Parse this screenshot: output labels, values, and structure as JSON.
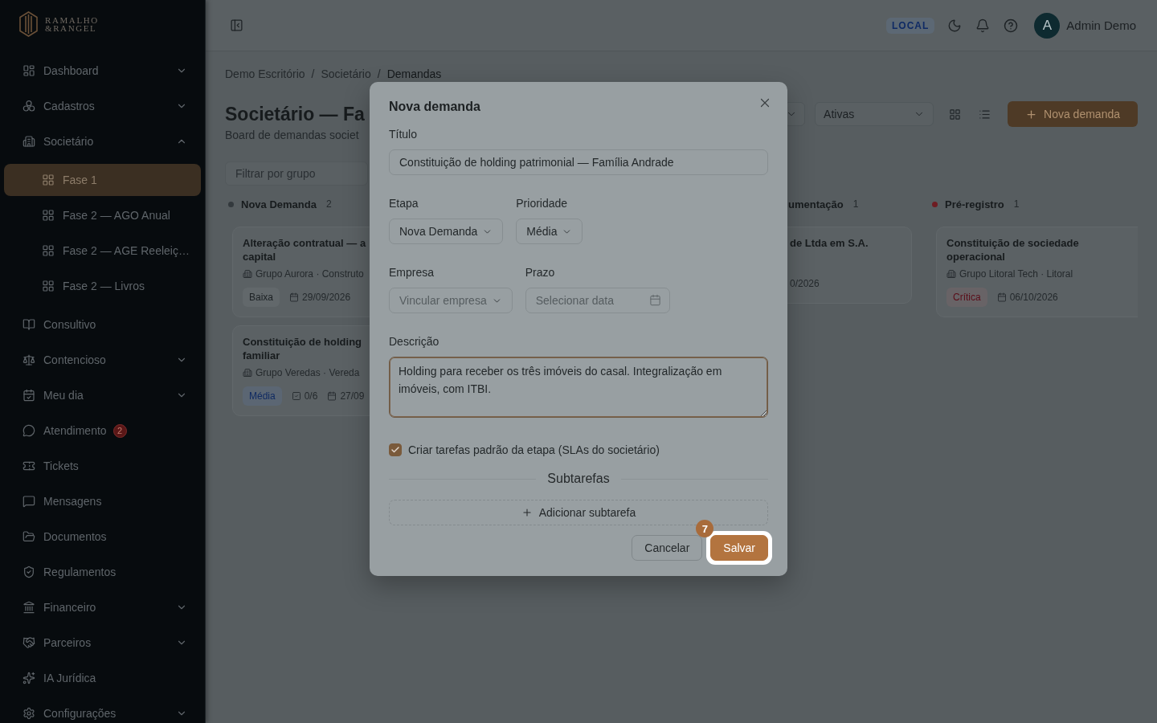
{
  "brand": {
    "lines": [
      "RAMALHO",
      "&RANGEL"
    ]
  },
  "sidebar": {
    "items": [
      {
        "label": "Dashboard",
        "selected": false,
        "expanded": false
      },
      {
        "label": "Cadastros",
        "selected": false,
        "expanded": false
      },
      {
        "label": "Societário",
        "selected": false,
        "expanded": true,
        "children": [
          {
            "label": "Fase 1",
            "selected": true
          },
          {
            "label": "Fase 2 — AGO Anual",
            "selected": false
          },
          {
            "label": "Fase 2 — AGE Reeleiç…",
            "selected": false
          },
          {
            "label": "Fase 2 — Livros",
            "selected": false
          }
        ]
      },
      {
        "label": "Consultivo",
        "selected": false
      },
      {
        "label": "Contencioso",
        "selected": false,
        "expanded": false
      },
      {
        "label": "Meu dia",
        "selected": false,
        "expanded": false
      },
      {
        "label": "Atendimento",
        "selected": false,
        "badge": "2"
      },
      {
        "label": "Tickets",
        "selected": false
      },
      {
        "label": "Mensagens",
        "selected": false
      },
      {
        "label": "Documentos",
        "selected": false
      },
      {
        "label": "Regulamentos",
        "selected": false
      },
      {
        "label": "Financeiro",
        "selected": false,
        "expanded": false
      },
      {
        "label": "Parceiros",
        "selected": false,
        "expanded": false
      },
      {
        "label": "IA Jurídica",
        "selected": false
      },
      {
        "label": "Configurações",
        "selected": false,
        "expanded": false
      }
    ]
  },
  "topbar": {
    "env_badge": "LOCAL",
    "user": {
      "initial": "A",
      "name": "Admin Demo"
    }
  },
  "breadcrumb": {
    "items": [
      "Demo Escritório",
      "Societário",
      "Demandas"
    ],
    "separator": "/"
  },
  "header": {
    "title": "Societário — Fa",
    "subtitle": "Board de demandas societ",
    "status_select": "Ativas",
    "new_button": "Nova demanda"
  },
  "filter": {
    "placeholder": "Filtrar por grupo"
  },
  "board": {
    "columns": [
      {
        "kind": "full",
        "title": "Nova Demanda",
        "count": "2",
        "color": "#33393d",
        "cards": [
          {
            "title_lines": [
              "Alteração contratual — a",
              "capital"
            ],
            "company": "Grupo Aurora · Construto",
            "priority": {
              "label": "Baixa",
              "kind": "low"
            },
            "date": "29/09/2026"
          },
          {
            "title_lines": [
              "Constituição de holding",
              "familiar"
            ],
            "company": "Grupo Veredas · Vereda",
            "priority": {
              "label": "Média",
              "kind": "medium"
            },
            "subtasks": "0/6",
            "date": "27/09"
          }
        ]
      },
      {
        "kind": "cut",
        "title": "umentação",
        "count": "1",
        "cards": [
          {
            "title_lines": [
              "de Ltda em S.A."
            ],
            "date": "0/2026"
          }
        ]
      },
      {
        "kind": "full",
        "title": "Pré-registro",
        "count": "1",
        "color": "#6e1c22",
        "cards": [
          {
            "title_lines": [
              "Constituição de sociedade",
              "operacional"
            ],
            "company": "Grupo Litoral Tech · Litoral",
            "priority": {
              "label": "Crítica",
              "kind": "critical"
            },
            "date": "06/10/2026"
          }
        ]
      }
    ]
  },
  "modal": {
    "title": "Nova demanda",
    "title_field": {
      "label": "Título",
      "value": "Constituição de holding patrimonial — Família Andrade"
    },
    "stage": {
      "label": "Etapa",
      "value": "Nova Demanda"
    },
    "priority": {
      "label": "Prioridade",
      "value": "Média"
    },
    "company": {
      "label": "Empresa",
      "placeholder": "Vincular empresa"
    },
    "deadline": {
      "label": "Prazo",
      "placeholder": "Selecionar data"
    },
    "description": {
      "label": "Descrição",
      "value": "Holding para receber os três imóveis do casal. Integralização em imóveis, com ITBI.",
      "focused": true
    },
    "create_tasks": {
      "label": "Criar tarefas padrão da etapa (SLAs do societário)",
      "checked": true
    },
    "subtasks": {
      "title": "Subtarefas",
      "add_button": "Adicionar subtarefa"
    },
    "buttons": [
      {
        "label": "Cancelar",
        "kind": "secondary",
        "highlighted": false
      },
      {
        "label": "Salvar",
        "kind": "primary",
        "highlighted": true
      }
    ],
    "tour_step": "7"
  }
}
